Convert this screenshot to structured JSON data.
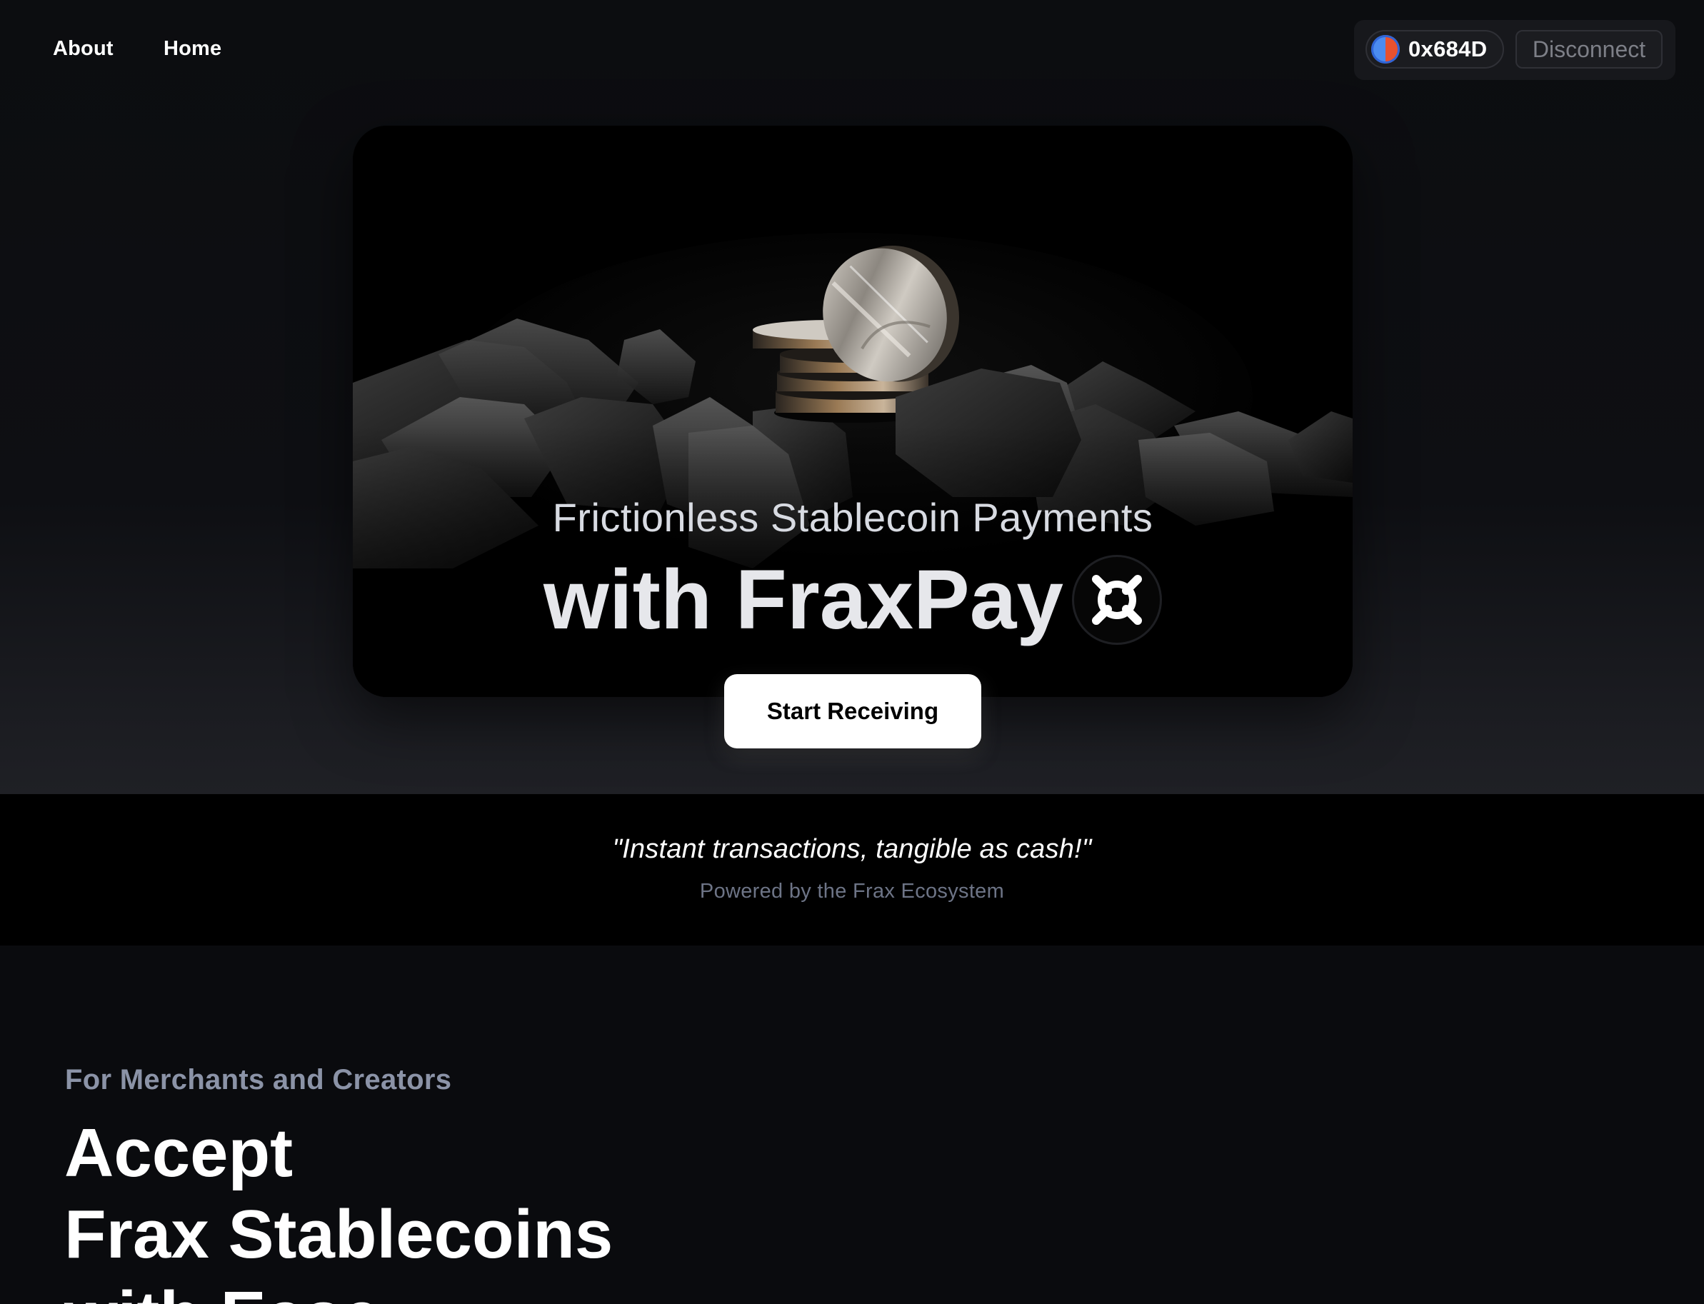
{
  "nav": {
    "about_label": "About",
    "home_label": "Home"
  },
  "wallet": {
    "address": "0x684D",
    "disconnect_label": "Disconnect"
  },
  "hero": {
    "subtitle": "Frictionless Stablecoin Payments",
    "title": "with FraxPay",
    "logo_icon": "frax-logo-icon",
    "cta_label": "Start Receiving"
  },
  "tagline": {
    "quote": "\"Instant transactions, tangible as cash!\"",
    "powered_by": "Powered by the Frax Ecosystem"
  },
  "merchants": {
    "eyebrow": "For Merchants and Creators",
    "heading_line_1": "Accept",
    "heading_line_2": "Frax Stablecoins",
    "heading_line_3": "with Ease"
  },
  "colors": {
    "page_background": "#0a0b0e",
    "hero_card": "#000000",
    "cta_background": "#ffffff",
    "muted_text": "#6d7486",
    "eyebrow_text": "#8b93a7"
  }
}
